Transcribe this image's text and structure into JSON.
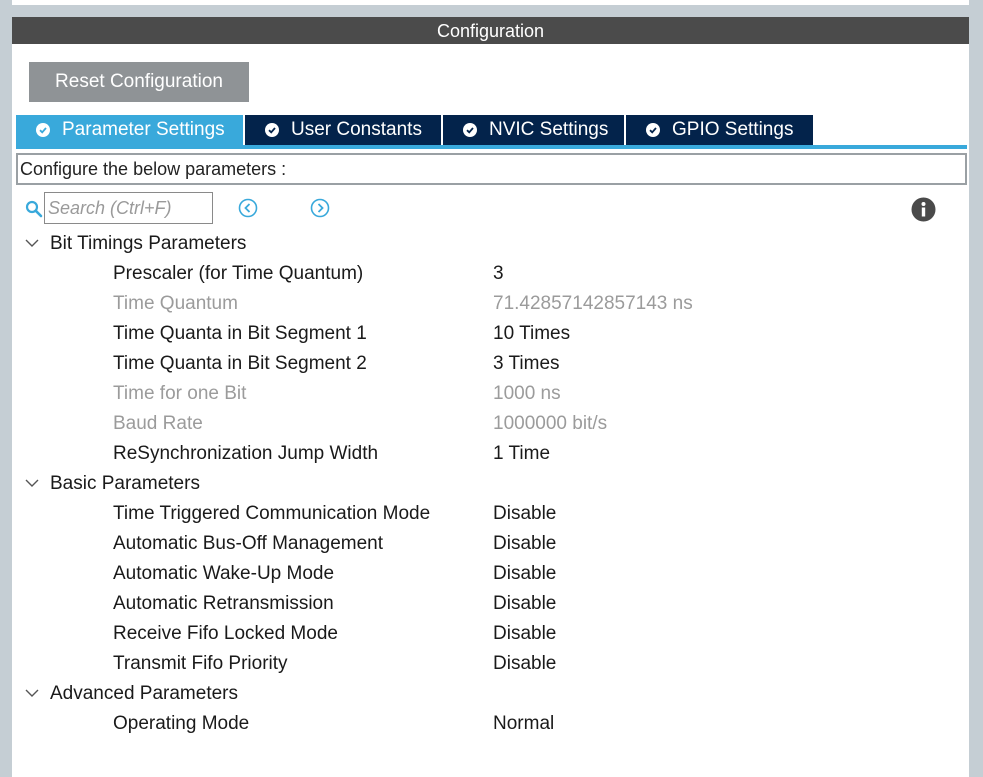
{
  "panel": {
    "title": "Configuration"
  },
  "reset_button_label": "Reset Configuration",
  "tabs": [
    {
      "label": "Parameter Settings",
      "active": true
    },
    {
      "label": "User Constants",
      "active": false
    },
    {
      "label": "NVIC Settings",
      "active": false
    },
    {
      "label": "GPIO Settings",
      "active": false
    }
  ],
  "description": "Configure the below parameters :",
  "search": {
    "placeholder": "Search (Ctrl+F)",
    "value": ""
  },
  "icons": {
    "search": "search-icon",
    "prev": "chevron-left-circle-icon",
    "next": "chevron-right-circle-icon",
    "info": "info-icon",
    "tab_check": "check-circle-icon",
    "expand": "chevron-down-icon"
  },
  "colors": {
    "title_bar": "#4b4b4b",
    "reset_button": "#8f9396",
    "tab_active": "#39a9db",
    "tab_inactive": "#03234b",
    "accent": "#39a9db",
    "disabled_text": "#9b9b9b"
  },
  "sections": [
    {
      "title": "Bit Timings Parameters",
      "params": [
        {
          "name": "Prescaler (for Time Quantum)",
          "value": "3",
          "editable": true
        },
        {
          "name": "Time Quantum",
          "value": "71.42857142857143 ns",
          "editable": false
        },
        {
          "name": "Time Quanta in Bit Segment 1",
          "value": "10 Times",
          "editable": true
        },
        {
          "name": "Time Quanta in Bit Segment 2",
          "value": "3 Times",
          "editable": true
        },
        {
          "name": "Time for one Bit",
          "value": "1000 ns",
          "editable": false
        },
        {
          "name": "Baud Rate",
          "value": "1000000 bit/s",
          "editable": false
        },
        {
          "name": "ReSynchronization Jump Width",
          "value": "1 Time",
          "editable": true
        }
      ]
    },
    {
      "title": "Basic Parameters",
      "params": [
        {
          "name": "Time Triggered Communication Mode",
          "value": "Disable",
          "editable": true
        },
        {
          "name": "Automatic Bus-Off Management",
          "value": "Disable",
          "editable": true
        },
        {
          "name": "Automatic Wake-Up Mode",
          "value": "Disable",
          "editable": true
        },
        {
          "name": "Automatic Retransmission",
          "value": "Disable",
          "editable": true
        },
        {
          "name": "Receive Fifo Locked Mode",
          "value": "Disable",
          "editable": true
        },
        {
          "name": "Transmit Fifo Priority",
          "value": "Disable",
          "editable": true
        }
      ]
    },
    {
      "title": "Advanced Parameters",
      "params": [
        {
          "name": "Operating Mode",
          "value": "Normal",
          "editable": true
        }
      ]
    }
  ]
}
